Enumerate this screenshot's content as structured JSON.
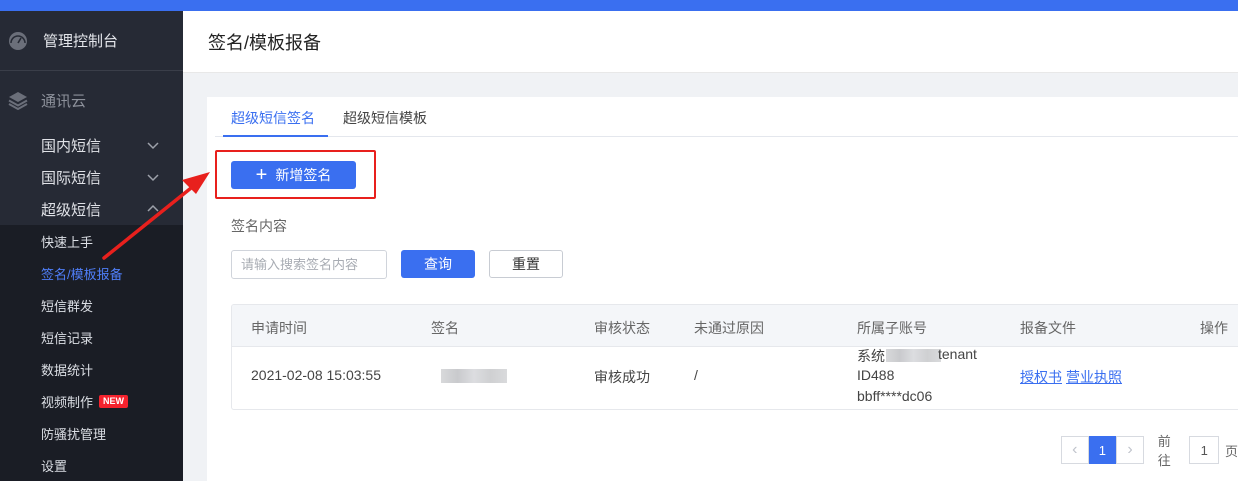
{
  "sidebar": {
    "brand": "管理控制台",
    "section": "通讯云",
    "menus": [
      {
        "label": "国内短信",
        "expanded": false
      },
      {
        "label": "国际短信",
        "expanded": false
      },
      {
        "label": "超级短信",
        "expanded": true
      }
    ],
    "submenu": [
      {
        "label": "快速上手"
      },
      {
        "label": "签名/模板报备",
        "active": true
      },
      {
        "label": "短信群发"
      },
      {
        "label": "短信记录"
      },
      {
        "label": "数据统计"
      },
      {
        "label": "视频制作",
        "badge": "NEW"
      },
      {
        "label": "防骚扰管理"
      },
      {
        "label": "设置"
      }
    ]
  },
  "header": {
    "title": "签名/模板报备"
  },
  "tabs": [
    {
      "label": "超级短信签名",
      "active": true
    },
    {
      "label": "超级短信模板",
      "active": false
    }
  ],
  "toolbar": {
    "add_label": "新增签名"
  },
  "filter": {
    "label": "签名内容",
    "placeholder": "请输入搜索签名内容",
    "query_label": "查询",
    "reset_label": "重置"
  },
  "table": {
    "headers": [
      "申请时间",
      "签名",
      "审核状态",
      "未通过原因",
      "所属子账号",
      "报备文件",
      "操作"
    ],
    "rows": [
      {
        "time": "2021-02-08 15:03:55",
        "status": "审核成功",
        "reason": "/",
        "account_line1_prefix": "系统",
        "account_line1_suffix": "tenant",
        "account_line2": "ID488",
        "account_line3": "bbff****dc06",
        "file1": "授权书",
        "file2": "营业执照"
      }
    ]
  },
  "pager": {
    "current": "1",
    "goto_label": "前往",
    "goto_value": "1",
    "unit": "页"
  },
  "colors": {
    "accent": "#3a6ff0",
    "sidebar_bg": "#262a35",
    "highlight_red": "#e8201d"
  }
}
